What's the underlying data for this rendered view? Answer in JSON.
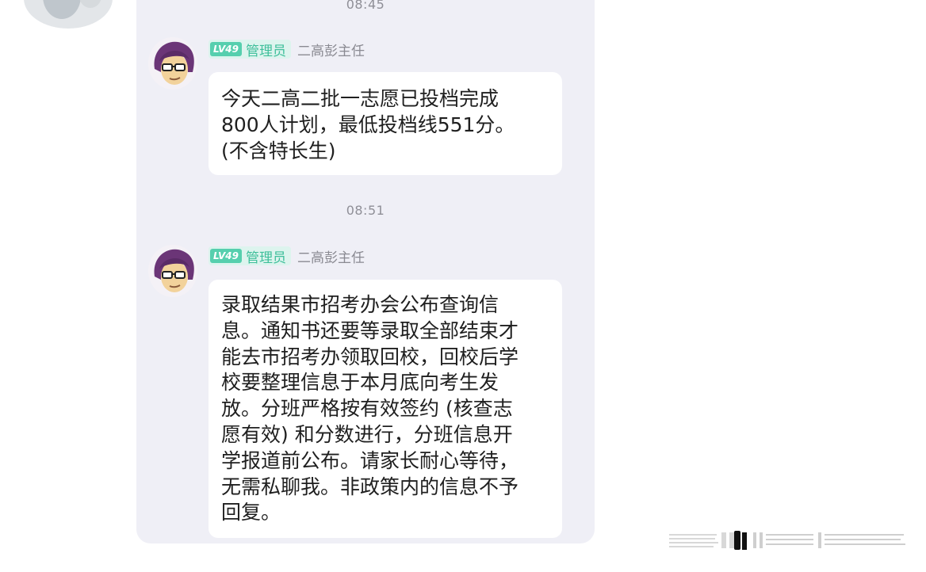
{
  "chat": {
    "messages": [
      {
        "time": "08:45",
        "level": "LV49",
        "role": "管理员",
        "sender": "二高彭主任",
        "lines": [
          "今天二高二批一志愿已投档完成",
          "800人计划，最低投档线551分。",
          "(不含特长生)"
        ]
      },
      {
        "time": "08:51",
        "level": "LV49",
        "role": "管理员",
        "sender": "二高彭主任",
        "lines": [
          "录取结果市招考办会公布查询信",
          "息。通知书还要等录取全部结束才",
          "能去市招考办领取回校，回校后学",
          "校要整理信息于本月底向考生发",
          "放。分班严格按有效签约 (核查志",
          "愿有效) 和分数进行，分班信息开",
          "学报道前公布。请家长耐心等待，",
          "无需私聊我。非政策内的信息不予",
          "回复。"
        ]
      }
    ]
  },
  "colors": {
    "panel": "#efeff6",
    "bubble": "#ffffff",
    "role_text": "#3fbf9b",
    "level_badge": "#56cfae"
  },
  "icons": {
    "avatar": "cartoon-avatar-icon"
  }
}
